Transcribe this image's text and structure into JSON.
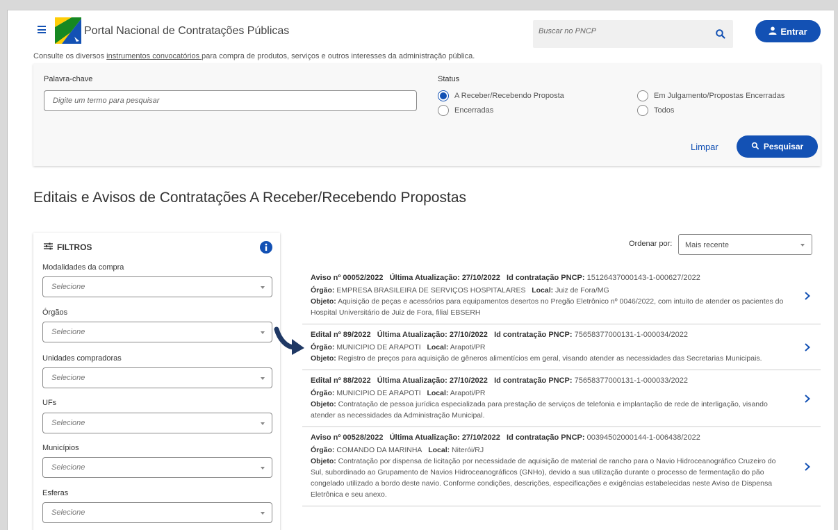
{
  "header": {
    "site_title": "Portal Nacional de Contratações Públicas",
    "search_placeholder": "Buscar no PNCP",
    "login_label": "Entrar"
  },
  "intro": {
    "before": "Consulte os diversos ",
    "link": "instrumentos convocatórios ",
    "after": "para compra de produtos, serviços e outros interesses da administração pública."
  },
  "search_panel": {
    "keyword_label": "Palavra-chave",
    "keyword_placeholder": "Digite um termo para pesquisar",
    "status_label": "Status",
    "status_options": [
      {
        "label": "A Receber/Recebendo Proposta",
        "selected": true
      },
      {
        "label": "Em Julgamento/Propostas Encerradas",
        "selected": false
      },
      {
        "label": "Encerradas",
        "selected": false
      },
      {
        "label": "Todos",
        "selected": false
      }
    ],
    "clear_label": "Limpar",
    "search_label": "Pesquisar"
  },
  "page_title": "Editais e Avisos de Contratações A Receber/Recebendo Propostas",
  "filters": {
    "title": "FILTROS",
    "items": [
      {
        "label": "Modalidades da compra",
        "value": "Selecione"
      },
      {
        "label": "Órgãos",
        "value": "Selecione"
      },
      {
        "label": "Unidades compradoras",
        "value": "Selecione"
      },
      {
        "label": "UFs",
        "value": "Selecione"
      },
      {
        "label": "Municípios",
        "value": "Selecione"
      },
      {
        "label": "Esferas",
        "value": "Selecione"
      }
    ]
  },
  "sort": {
    "label": "Ordenar por:",
    "value": "Mais recente"
  },
  "labels": {
    "updated": "Última Atualização:",
    "pncp_id": "Id contratação PNCP:",
    "orgao": "Órgão:",
    "local": "Local:",
    "objeto": "Objeto:"
  },
  "results": [
    {
      "title": "Aviso nº 00052/2022",
      "updated": "27/10/2022",
      "pncp_id": "15126437000143-1-000627/2022",
      "orgao": "EMPRESA BRASILEIRA DE SERVIÇOS HOSPITALARES",
      "local": "Juiz de Fora/MG",
      "objeto": "Aquisição de peças e acessórios para equipamentos desertos no Pregão Eletrônico nº 0046/2022, com intuito de atender os pacientes do Hospital Universitário de Juiz de Fora, filial EBSERH"
    },
    {
      "title": "Edital nº 89/2022",
      "updated": "27/10/2022",
      "pncp_id": "75658377000131-1-000034/2022",
      "orgao": "MUNICIPIO DE ARAPOTI",
      "local": "Arapoti/PR",
      "objeto": "Registro de preços para aquisição de gêneros alimentícios em geral, visando atender as necessidades das Secretarias Municipais."
    },
    {
      "title": "Edital nº 88/2022",
      "updated": "27/10/2022",
      "pncp_id": "75658377000131-1-000033/2022",
      "orgao": "MUNICIPIO DE ARAPOTI",
      "local": "Arapoti/PR",
      "objeto": "Contratação de pessoa jurídica especializada para prestação de serviços de telefonia e implantação de rede de interligação, visando atender as necessidades da Administração Municipal."
    },
    {
      "title": "Aviso nº 00528/2022",
      "updated": "27/10/2022",
      "pncp_id": "00394502000144-1-006438/2022",
      "orgao": "COMANDO DA MARINHA",
      "local": "Niterói/RJ",
      "objeto": "Contratação por dispensa de licitação por necessidade de aquisição de material de rancho para o Navio Hidroceanográfico Cruzeiro do Sul, subordinado ao Grupamento de Navios Hidroceanográficos (GNHo), devido a sua utilização durante o processo de fermentação do pão congelado utilizado a bordo deste navio. Conforme condições, descrições, especificações e exigências estabelecidas neste Aviso de Dispensa Eletrônica e seu anexo."
    }
  ],
  "colors": {
    "primary": "#1351b4",
    "logo_green": "#168821",
    "logo_yellow": "#ffcd07",
    "logo_blue": "#1351b4"
  }
}
